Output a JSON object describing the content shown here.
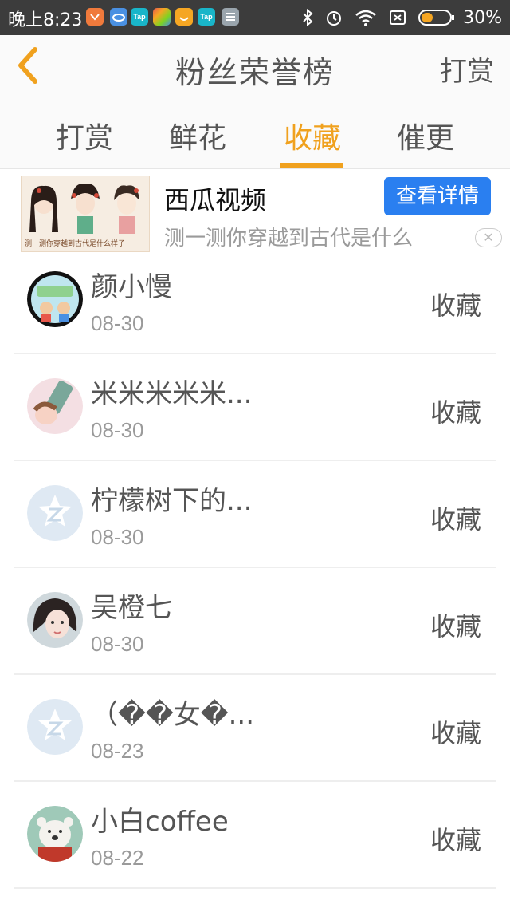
{
  "status_bar": {
    "time": "晚上8:23",
    "battery": "30%",
    "app_icons": [
      {
        "name": "mi-store-icon",
        "label": "",
        "color": "#f07a3c"
      },
      {
        "name": "cloud-app-icon",
        "label": "",
        "color": "#4a90e2"
      },
      {
        "name": "taptap-icon",
        "label": "Tap",
        "color": "#19b5c9"
      },
      {
        "name": "game-center-icon",
        "label": "",
        "color": "#e8574b"
      },
      {
        "name": "smile-app-icon",
        "label": "",
        "color": "#f5a623"
      },
      {
        "name": "taptap-icon",
        "label": "Tap",
        "color": "#19b5c9"
      },
      {
        "name": "notes-app-icon",
        "label": "",
        "color": "#9aa5ad"
      }
    ]
  },
  "header": {
    "title": "粉丝荣誉榜",
    "right_link": "打赏",
    "back_color": "#f0a11e"
  },
  "tabs": [
    {
      "label": "打赏",
      "active": false
    },
    {
      "label": "鲜花",
      "active": false
    },
    {
      "label": "收藏",
      "active": true
    },
    {
      "label": "催更",
      "active": false
    }
  ],
  "accent_color": "#f0a11e",
  "ad": {
    "title": "西瓜视频",
    "description": "测一测你穿越到古代是什么",
    "button": "查看详情",
    "image_caption": "测一测你穿越到古代是什么样子",
    "close_symbol": "✕"
  },
  "list": [
    {
      "name": "颜小慢",
      "date": "08-30",
      "action": "收藏",
      "avatar": "cartoon-avatar"
    },
    {
      "name": "米米米米米...",
      "date": "08-30",
      "action": "收藏",
      "avatar": "anime-avatar"
    },
    {
      "name": "柠檬树下的...",
      "date": "08-30",
      "action": "收藏",
      "avatar": "default-qq-avatar"
    },
    {
      "name": "吴橙七",
      "date": "08-30",
      "action": "收藏",
      "avatar": "photo-avatar"
    },
    {
      "name": "（��女�...",
      "date": "08-23",
      "action": "收藏",
      "avatar": "default-qq-avatar"
    },
    {
      "name": "小白coffee",
      "date": "08-22",
      "action": "收藏",
      "avatar": "bear-avatar"
    }
  ]
}
